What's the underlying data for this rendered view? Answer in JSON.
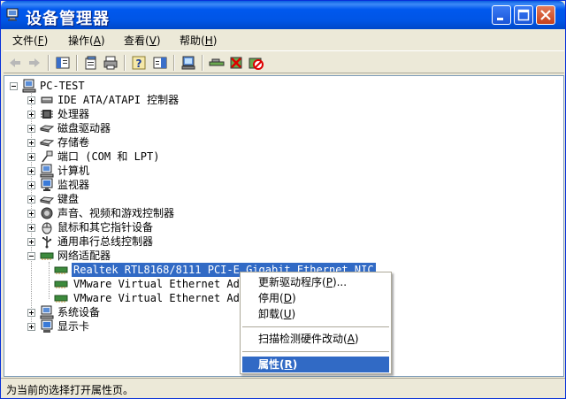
{
  "window": {
    "title": "设备管理器"
  },
  "menubar": [
    {
      "label": "文件(",
      "key": "F",
      "suffix": ")"
    },
    {
      "label": "操作(",
      "key": "A",
      "suffix": ")"
    },
    {
      "label": "查看(",
      "key": "V",
      "suffix": ")"
    },
    {
      "label": "帮助(",
      "key": "H",
      "suffix": ")"
    }
  ],
  "toolbar": {
    "icons": [
      "back-arrow-icon",
      "forward-arrow-icon",
      "show-hide-tree-icon",
      "properties-icon",
      "print-icon",
      "help-icon",
      "show-hide-action-pane-icon",
      "scan-hardware-icon",
      "update-driver-icon",
      "uninstall-icon",
      "disable-icon"
    ]
  },
  "tree": {
    "root": "PC-TEST",
    "categories": [
      {
        "label": "IDE ATA/ATAPI 控制器",
        "icon": "ide-controller-icon"
      },
      {
        "label": "处理器",
        "icon": "processor-icon"
      },
      {
        "label": "磁盘驱动器",
        "icon": "disk-drive-icon"
      },
      {
        "label": "存储卷",
        "icon": "storage-volume-icon"
      },
      {
        "label": "端口 (COM 和 LPT)",
        "icon": "port-icon"
      },
      {
        "label": "计算机",
        "icon": "computer-icon"
      },
      {
        "label": "监视器",
        "icon": "monitor-icon"
      },
      {
        "label": "键盘",
        "icon": "keyboard-icon"
      },
      {
        "label": "声音、视频和游戏控制器",
        "icon": "sound-icon"
      },
      {
        "label": "鼠标和其它指针设备",
        "icon": "mouse-icon"
      },
      {
        "label": "通用串行总线控制器",
        "icon": "usb-icon"
      },
      {
        "label": "网络适配器",
        "icon": "network-adapter-icon"
      }
    ],
    "network_children": [
      {
        "label": "Realtek RTL8168/8111 PCI-E Gigabit Ethernet NIC",
        "selected": true
      },
      {
        "label": "VMware Virtual Ethernet Adapter for VMnet1"
      },
      {
        "label": "VMware Virtual Ethernet Adapter for VMnet8"
      }
    ],
    "after": [
      {
        "label": "系统设备",
        "icon": "system-devices-icon"
      },
      {
        "label": "显示卡",
        "icon": "display-adapter-icon"
      }
    ]
  },
  "context_menu": [
    {
      "label": "更新驱动程序(",
      "key": "P",
      "suffix": ")..."
    },
    {
      "label": "停用(",
      "key": "D",
      "suffix": ")"
    },
    {
      "label": "卸载(",
      "key": "U",
      "suffix": ")"
    },
    {
      "label": "扫描检测硬件改动(",
      "key": "A",
      "suffix": ")"
    },
    {
      "label": "属性(",
      "key": "R",
      "suffix": ")"
    }
  ],
  "status": {
    "text": "为当前的选择打开属性页。"
  },
  "colors": {
    "titlebar": "#0055e5",
    "selection": "#316ac5",
    "chrome": "#ece9d8"
  }
}
